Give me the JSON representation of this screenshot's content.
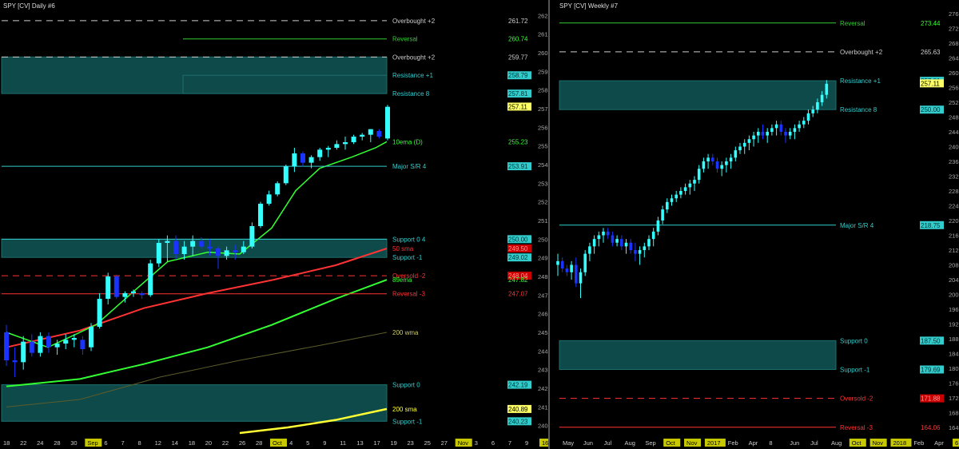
{
  "chart_data": [
    {
      "type": "candlestick",
      "title": "SPY [CV]  Daily  #6",
      "ylim": [
        239.6,
        262.4
      ],
      "y_ticks": [
        240,
        241,
        242,
        243,
        244,
        245,
        246,
        247,
        248,
        249,
        250,
        251,
        252,
        253,
        254,
        255,
        256,
        257,
        258,
        259,
        260,
        261,
        262
      ],
      "x_labels": [
        "18",
        "22",
        "24",
        "28",
        "30",
        "Sep",
        "6",
        "7",
        "8",
        "12",
        "14",
        "18",
        "20",
        "22",
        "26",
        "28",
        "Oct",
        "4",
        "5",
        "9",
        "11",
        "13",
        "17",
        "19",
        "23",
        "25",
        "27",
        "Nov",
        "3",
        "6",
        "7",
        "9",
        "16"
      ],
      "zones": [
        {
          "y1": 257.81,
          "y2": 259.77
        },
        {
          "y1": 258.79,
          "y2": 257.81
        },
        {
          "y1": 249.02,
          "y2": 250.0
        },
        {
          "y1": 240.23,
          "y2": 242.19
        }
      ],
      "levels": [
        {
          "label": "Overbought +2",
          "value": 261.72,
          "value_label": "261.72",
          "color": "#cccccc",
          "style": "dashed",
          "tag": "plain"
        },
        {
          "label": "Reversal",
          "value": 260.74,
          "value_label": "260.74",
          "color": "#33cc33",
          "style": "solid",
          "tag": "green"
        },
        {
          "label": "Overbought +2",
          "value": 259.77,
          "value_label": "259.77",
          "color": "#cccccc",
          "style": "dashed",
          "tag": "plain"
        },
        {
          "label": "Resistance +1",
          "value": 258.79,
          "value_label": "258.79",
          "color": "#33cccc",
          "style": "none",
          "tag": "cyan"
        },
        {
          "label": "Resistance 8",
          "value": 257.81,
          "value_label": "257.81",
          "color": "#33cccc",
          "style": "none",
          "tag": "cyan"
        },
        {
          "label": "",
          "value": 257.11,
          "value_label": "257.11",
          "color": "#ffff66",
          "style": "none",
          "tag": "yellow"
        },
        {
          "label": "10ema (D)",
          "value": 255.23,
          "value_label": "255.23",
          "color": "#33ff33",
          "style": "none",
          "tag": "green"
        },
        {
          "label": "Major S/R 4",
          "value": 253.91,
          "value_label": "253.91",
          "color": "#33cccc",
          "style": "solid",
          "tag": "cyan"
        },
        {
          "label": "Support 0 4",
          "value": 250.0,
          "value_label": "250.00",
          "color": "#33cccc",
          "style": "solid",
          "tag": "cyan"
        },
        {
          "label": "50 sma",
          "value": 249.5,
          "value_label": "249.50",
          "color": "#ff3333",
          "style": "none",
          "tag": "red"
        },
        {
          "label": "Support -1",
          "value": 249.02,
          "value_label": "249.02",
          "color": "#33cccc",
          "style": "none",
          "tag": "cyan"
        },
        {
          "label": "Oversold -2",
          "value": 248.04,
          "value_label": "248.04",
          "color": "#ff3333",
          "style": "dashed",
          "tag": "red"
        },
        {
          "label": "89ema",
          "value": 247.82,
          "value_label": "247.82",
          "color": "#33ff33",
          "style": "none",
          "tag": "green"
        },
        {
          "label": "Reversal -3",
          "value": 247.07,
          "value_label": "247.07",
          "color": "#ff3333",
          "style": "solid",
          "tag": "none"
        },
        {
          "label": "200 wma",
          "value": 245.0,
          "value_label": "",
          "color": "#cccc66",
          "style": "none",
          "tag": "none"
        },
        {
          "label": "Support 0",
          "value": 242.19,
          "value_label": "242.19",
          "color": "#33cccc",
          "style": "none",
          "tag": "cyan"
        },
        {
          "label": "200 sma",
          "value": 240.89,
          "value_label": "240.89",
          "color": "#ffff33",
          "style": "none",
          "tag": "yellow"
        },
        {
          "label": "Support -1",
          "value": 240.23,
          "value_label": "240.23",
          "color": "#33cccc",
          "style": "none",
          "tag": "cyan"
        }
      ],
      "candles": [
        [
          245.0,
          245.4,
          243.2,
          243.5
        ],
        [
          243.5,
          244.2,
          242.6,
          243.4
        ],
        [
          243.4,
          244.8,
          243.0,
          244.5
        ],
        [
          244.5,
          244.9,
          243.7,
          243.9
        ],
        [
          243.9,
          245.0,
          243.7,
          244.8
        ],
        [
          244.8,
          245.0,
          243.9,
          244.2
        ],
        [
          244.2,
          244.6,
          243.8,
          244.4
        ],
        [
          244.4,
          244.9,
          244.1,
          244.6
        ],
        [
          244.6,
          244.9,
          244.2,
          244.7
        ],
        [
          244.6,
          244.8,
          243.8,
          244.1
        ],
        [
          244.2,
          245.5,
          244.0,
          245.3
        ],
        [
          245.3,
          247.1,
          245.2,
          246.8
        ],
        [
          246.8,
          248.2,
          246.5,
          248.0
        ],
        [
          248.0,
          248.1,
          246.8,
          246.9
        ],
        [
          246.9,
          247.2,
          246.6,
          247.1
        ],
        [
          247.1,
          247.3,
          246.9,
          247.2
        ],
        [
          247.1,
          247.2,
          246.8,
          247.0
        ],
        [
          247.0,
          248.9,
          246.9,
          248.7
        ],
        [
          248.7,
          250.0,
          248.5,
          249.8
        ],
        [
          249.8,
          250.2,
          248.8,
          249.9
        ],
        [
          249.9,
          250.2,
          248.9,
          249.2
        ],
        [
          249.2,
          249.9,
          248.9,
          249.6
        ],
        [
          249.6,
          250.2,
          249.1,
          249.9
        ],
        [
          249.9,
          250.1,
          249.5,
          249.6
        ],
        [
          249.6,
          250.0,
          249.1,
          249.5
        ],
        [
          249.5,
          249.6,
          248.4,
          249.1
        ],
        [
          249.1,
          249.6,
          248.9,
          249.4
        ],
        [
          249.4,
          249.7,
          248.9,
          249.3
        ],
        [
          249.3,
          249.9,
          249.2,
          249.6
        ],
        [
          249.6,
          250.9,
          249.5,
          250.7
        ],
        [
          250.7,
          252.0,
          250.6,
          251.9
        ],
        [
          251.9,
          252.6,
          251.8,
          252.4
        ],
        [
          252.4,
          253.1,
          252.3,
          253.0
        ],
        [
          253.0,
          254.0,
          252.9,
          253.9
        ],
        [
          253.9,
          254.9,
          253.6,
          254.6
        ],
        [
          254.6,
          254.7,
          253.9,
          254.1
        ],
        [
          254.1,
          254.5,
          253.8,
          254.4
        ],
        [
          254.4,
          254.9,
          254.2,
          254.8
        ],
        [
          254.8,
          255.0,
          254.4,
          254.9
        ],
        [
          254.9,
          255.3,
          254.8,
          255.1
        ],
        [
          255.1,
          255.5,
          254.8,
          255.2
        ],
        [
          255.2,
          255.6,
          255.1,
          255.5
        ],
        [
          255.5,
          255.7,
          255.3,
          255.6
        ],
        [
          255.6,
          255.9,
          255.2,
          255.9
        ],
        [
          255.8,
          255.9,
          255.4,
          255.5
        ],
        [
          255.4,
          257.2,
          255.3,
          257.1
        ]
      ],
      "x_start": 8,
      "x_step": 10.6
    },
    {
      "type": "candlestick",
      "title": "SPY [CV]  Weekly  #7",
      "ylim": [
        162.5,
        277.5
      ],
      "y_ticks": [
        164,
        168,
        172,
        176,
        180,
        184,
        188,
        192,
        196,
        200,
        204,
        208,
        212,
        216,
        220,
        224,
        228,
        232,
        236,
        240,
        244,
        248,
        252,
        256,
        260,
        264,
        268,
        272,
        276
      ],
      "x_labels": [
        "May",
        "Jun",
        "Jul",
        "Aug",
        "Sep",
        "Oct",
        "Nov",
        "2017",
        "Feb",
        "Apr",
        "8",
        "Jun",
        "Jul",
        "Aug",
        "Oct",
        "Nov",
        "2018",
        "Feb",
        "Apr",
        "6"
      ],
      "zones": [
        {
          "y1": 250.0,
          "y2": 257.81
        },
        {
          "y1": 179.69,
          "y2": 187.5
        }
      ],
      "levels": [
        {
          "label": "Reversal",
          "value": 273.44,
          "value_label": "273.44",
          "color": "#33cc33",
          "style": "solid",
          "tag": "green"
        },
        {
          "label": "Overbought +2",
          "value": 265.63,
          "value_label": "265.63",
          "color": "#cccccc",
          "style": "dashed",
          "tag": "plain"
        },
        {
          "label": "Resistance +1",
          "value": 257.81,
          "value_label": "257.81",
          "color": "#33cccc",
          "style": "none",
          "tag": "cyan"
        },
        {
          "label": "",
          "value": 257.11,
          "value_label": "257.11",
          "color": "#ffff66",
          "style": "none",
          "tag": "yellow"
        },
        {
          "label": "Resistance 8",
          "value": 250.0,
          "value_label": "250.00",
          "color": "#33cccc",
          "style": "none",
          "tag": "cyan"
        },
        {
          "label": "Major S/R 4",
          "value": 218.75,
          "value_label": "218.75",
          "color": "#33cccc",
          "style": "solid",
          "tag": "cyan"
        },
        {
          "label": "Support 0",
          "value": 187.5,
          "value_label": "187.50",
          "color": "#33cccc",
          "style": "none",
          "tag": "cyan"
        },
        {
          "label": "Support -1",
          "value": 179.69,
          "value_label": "179.69",
          "color": "#33cccc",
          "style": "none",
          "tag": "cyan"
        },
        {
          "label": "Oversold -2",
          "value": 171.88,
          "value_label": "171.88",
          "color": "#ff3333",
          "style": "dashed",
          "tag": "red"
        },
        {
          "label": "Reversal -3",
          "value": 164.06,
          "value_label": "164.06",
          "color": "#ff3333",
          "style": "solid",
          "tag": "none"
        }
      ],
      "candles": [
        [
          208,
          211,
          205,
          209
        ],
        [
          209,
          210,
          206,
          207
        ],
        [
          207,
          208,
          205,
          206
        ],
        [
          206,
          209,
          204,
          208
        ],
        [
          208,
          210,
          202,
          203
        ],
        [
          203,
          207,
          199,
          206
        ],
        [
          206,
          212,
          205,
          211
        ],
        [
          211,
          214,
          209,
          213
        ],
        [
          213,
          216,
          211,
          215
        ],
        [
          215,
          217,
          213,
          216
        ],
        [
          216,
          218,
          214,
          217
        ],
        [
          217,
          218,
          215,
          216
        ],
        [
          216,
          217,
          213,
          214
        ],
        [
          214,
          216,
          213,
          215
        ],
        [
          215,
          216,
          212,
          213
        ],
        [
          213,
          215,
          211,
          214
        ],
        [
          214,
          215,
          211,
          212
        ],
        [
          212,
          214,
          209,
          211
        ],
        [
          211,
          213,
          208,
          212
        ],
        [
          212,
          214,
          210,
          213
        ],
        [
          213,
          216,
          212,
          215
        ],
        [
          215,
          218,
          213,
          217
        ],
        [
          217,
          221,
          216,
          220
        ],
        [
          220,
          224,
          219,
          223
        ],
        [
          223,
          226,
          222,
          225
        ],
        [
          225,
          227,
          224,
          226
        ],
        [
          226,
          228,
          225,
          227
        ],
        [
          227,
          229,
          226,
          228
        ],
        [
          228,
          230,
          227,
          229
        ],
        [
          229,
          231,
          227,
          230
        ],
        [
          230,
          232,
          228,
          231
        ],
        [
          231,
          235,
          230,
          234
        ],
        [
          234,
          237,
          233,
          236
        ],
        [
          236,
          238,
          234,
          237
        ],
        [
          237,
          238,
          235,
          236
        ],
        [
          236,
          237,
          233,
          234
        ],
        [
          234,
          236,
          232,
          235
        ],
        [
          235,
          237,
          233,
          236
        ],
        [
          236,
          238,
          234,
          237
        ],
        [
          237,
          240,
          236,
          239
        ],
        [
          239,
          241,
          238,
          240
        ],
        [
          240,
          242,
          238,
          241
        ],
        [
          241,
          243,
          239,
          242
        ],
        [
          242,
          244,
          240,
          243
        ],
        [
          243,
          245,
          241,
          244
        ],
        [
          244,
          246,
          242,
          243
        ],
        [
          243,
          245,
          241,
          244
        ],
        [
          244,
          246,
          243,
          245
        ],
        [
          245,
          247,
          243,
          246
        ],
        [
          246,
          247,
          243,
          244
        ],
        [
          244,
          245,
          241,
          243
        ],
        [
          243,
          245,
          242,
          244
        ],
        [
          244,
          246,
          242,
          245
        ],
        [
          245,
          247,
          244,
          246
        ],
        [
          246,
          248,
          245,
          247
        ],
        [
          247,
          250,
          246,
          249
        ],
        [
          249,
          251,
          248,
          250
        ],
        [
          250,
          253,
          249,
          252
        ],
        [
          252,
          255,
          251,
          254
        ],
        [
          254,
          258,
          253,
          257
        ]
      ],
      "x_start": 8,
      "x_step": 5.7
    }
  ]
}
